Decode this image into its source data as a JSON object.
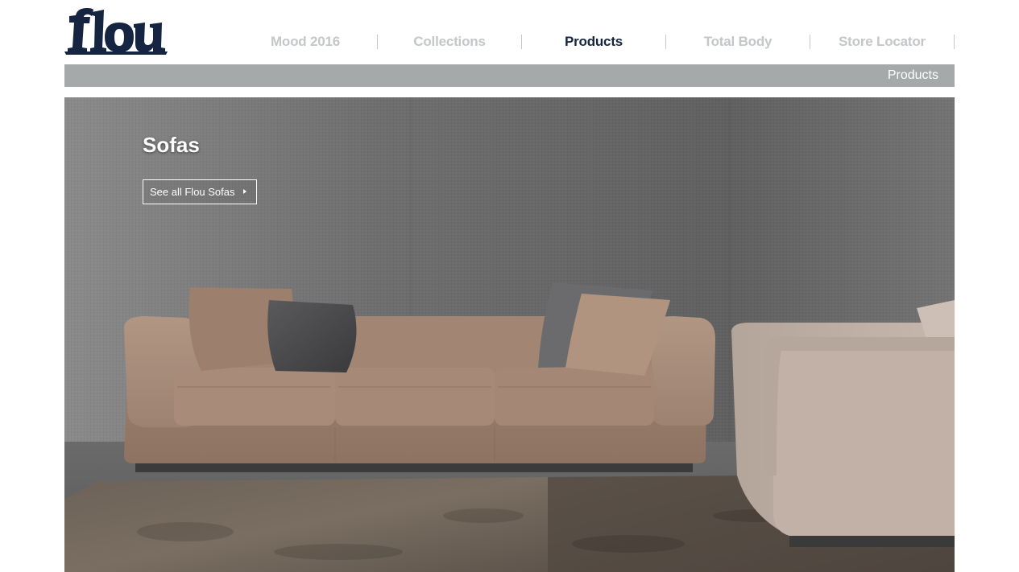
{
  "brand": {
    "logo_text": "Flou",
    "logo_color": "#152440"
  },
  "nav": {
    "items": [
      {
        "label": "Mood 2016"
      },
      {
        "label": "Collections"
      },
      {
        "label": "Products"
      },
      {
        "label": "Total Body"
      },
      {
        "label": "Store Locator"
      }
    ],
    "active_index": 2,
    "active_color": "#152440",
    "inactive_color": "#c4c6c8"
  },
  "breadcrumb": {
    "label": "Products"
  },
  "hero": {
    "title": "Sofas",
    "button_label": "See all Flou Sofas",
    "button_icon": "chevron-right-icon"
  }
}
